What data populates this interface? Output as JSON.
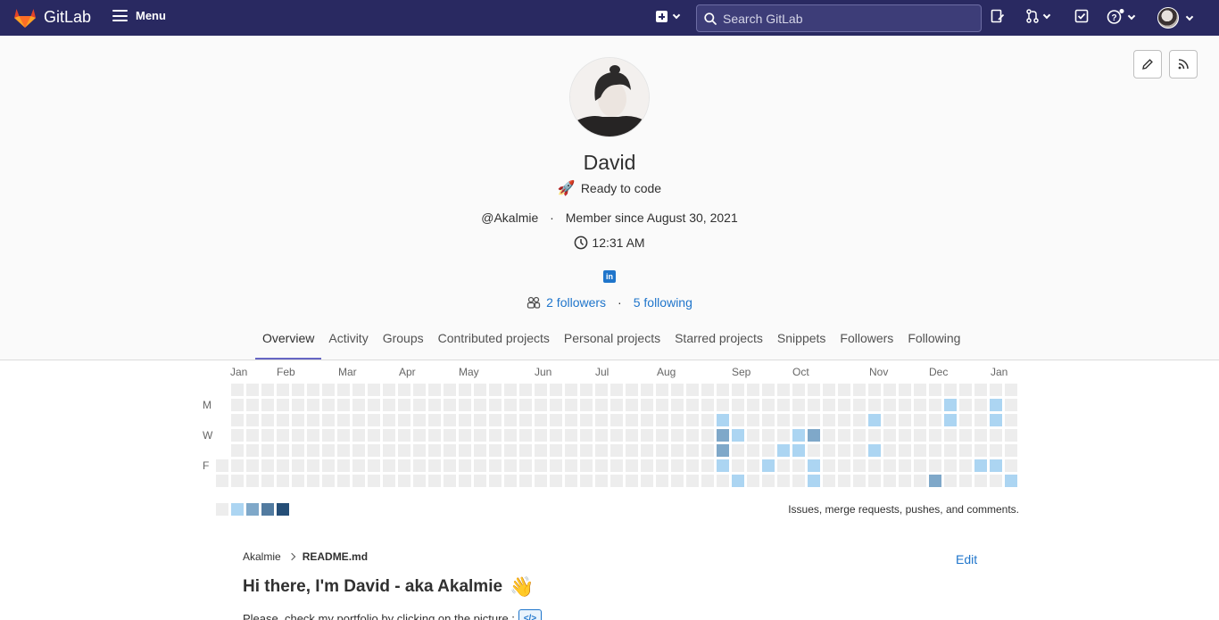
{
  "navbar": {
    "brand": "GitLab",
    "menu_label": "Menu",
    "search_placeholder": "Search GitLab"
  },
  "profile": {
    "name": "David",
    "status_emoji": "🚀",
    "status_text": "Ready to code",
    "username": "@Akalmie",
    "member_since": "Member since August 30, 2021",
    "local_time": "12:31 AM",
    "followers_label": "2 followers",
    "following_label": "5 following"
  },
  "tabs": [
    {
      "label": "Overview",
      "active": true
    },
    {
      "label": "Activity"
    },
    {
      "label": "Groups"
    },
    {
      "label": "Contributed projects"
    },
    {
      "label": "Personal projects"
    },
    {
      "label": "Starred projects"
    },
    {
      "label": "Snippets"
    },
    {
      "label": "Followers"
    },
    {
      "label": "Following"
    }
  ],
  "calendar": {
    "months": [
      "Jan",
      "Feb",
      "Mar",
      "Apr",
      "May",
      "Jun",
      "Jul",
      "Aug",
      "Sep",
      "Oct",
      "Nov",
      "Dec",
      "Jan"
    ],
    "day_labels": [
      "M",
      "W",
      "F"
    ],
    "legend_colors": [
      "#ededed",
      "#acd5f2",
      "#7fa8c9",
      "#527ba0",
      "#254e77"
    ],
    "legend_text": "Issues, merge requests, pushes, and comments.",
    "active_days": [
      {
        "week": 33,
        "day": 2,
        "level": 1
      },
      {
        "week": 33,
        "day": 3,
        "level": 2
      },
      {
        "week": 33,
        "day": 4,
        "level": 2
      },
      {
        "week": 33,
        "day": 5,
        "level": 1
      },
      {
        "week": 34,
        "day": 3,
        "level": 1
      },
      {
        "week": 34,
        "day": 6,
        "level": 1
      },
      {
        "week": 36,
        "day": 5,
        "level": 1
      },
      {
        "week": 37,
        "day": 4,
        "level": 1
      },
      {
        "week": 38,
        "day": 3,
        "level": 1
      },
      {
        "week": 38,
        "day": 4,
        "level": 1
      },
      {
        "week": 39,
        "day": 3,
        "level": 2
      },
      {
        "week": 39,
        "day": 5,
        "level": 1
      },
      {
        "week": 39,
        "day": 6,
        "level": 1
      },
      {
        "week": 43,
        "day": 2,
        "level": 1
      },
      {
        "week": 43,
        "day": 4,
        "level": 1
      },
      {
        "week": 47,
        "day": 6,
        "level": 2
      },
      {
        "week": 48,
        "day": 1,
        "level": 1
      },
      {
        "week": 48,
        "day": 2,
        "level": 1
      },
      {
        "week": 50,
        "day": 5,
        "level": 1
      },
      {
        "week": 51,
        "day": 1,
        "level": 1
      },
      {
        "week": 51,
        "day": 2,
        "level": 1
      },
      {
        "week": 51,
        "day": 5,
        "level": 1
      },
      {
        "week": 52,
        "day": 6,
        "level": 1
      }
    ]
  },
  "readme": {
    "breadcrumb_user": "Akalmie",
    "breadcrumb_file": "README.md",
    "edit_label": "Edit",
    "heading": "Hi there, I'm David - aka Akalmie",
    "heading_emoji": "👋",
    "paragraph": "Please, check my portfolio by clicking on the picture :"
  }
}
